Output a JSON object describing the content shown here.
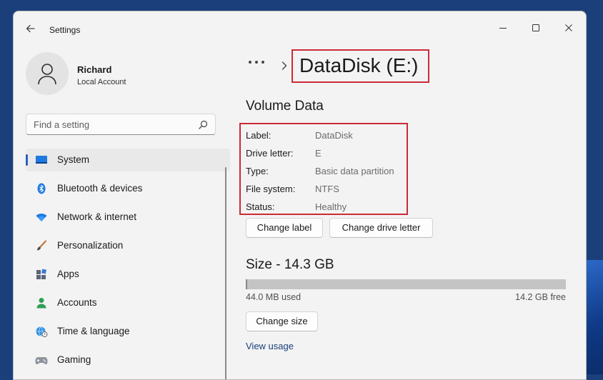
{
  "window": {
    "title": "Settings"
  },
  "account": {
    "name": "Richard",
    "type": "Local Account"
  },
  "search": {
    "placeholder": "Find a setting"
  },
  "nav": {
    "items": [
      {
        "label": "System",
        "icon": "monitor-icon",
        "active": true
      },
      {
        "label": "Bluetooth & devices",
        "icon": "bluetooth-icon"
      },
      {
        "label": "Network & internet",
        "icon": "wifi-icon"
      },
      {
        "label": "Personalization",
        "icon": "brush-icon"
      },
      {
        "label": "Apps",
        "icon": "apps-icon"
      },
      {
        "label": "Accounts",
        "icon": "person-icon"
      },
      {
        "label": "Time & language",
        "icon": "globe-clock-icon"
      },
      {
        "label": "Gaming",
        "icon": "gamepad-icon"
      }
    ]
  },
  "breadcrumb": {
    "overflow": "•••",
    "current": "DataDisk (E:)"
  },
  "volume": {
    "title": "Volume Data",
    "properties": [
      {
        "label": "Label:",
        "value": "DataDisk"
      },
      {
        "label": "Drive letter:",
        "value": "E"
      },
      {
        "label": "Type:",
        "value": "Basic data partition"
      },
      {
        "label": "File system:",
        "value": "NTFS"
      },
      {
        "label": "Status:",
        "value": "Healthy"
      }
    ],
    "change_label_button": "Change label",
    "change_letter_button": "Change drive letter"
  },
  "size": {
    "title": "Size - 14.3 GB",
    "used": "44.0 MB used",
    "free": "14.2 GB free",
    "used_fraction": 0.003,
    "change_size_button": "Change size",
    "view_usage_link": "View usage"
  },
  "colors": {
    "accent": "#2a5fbf",
    "highlight": "#cc2a36"
  }
}
